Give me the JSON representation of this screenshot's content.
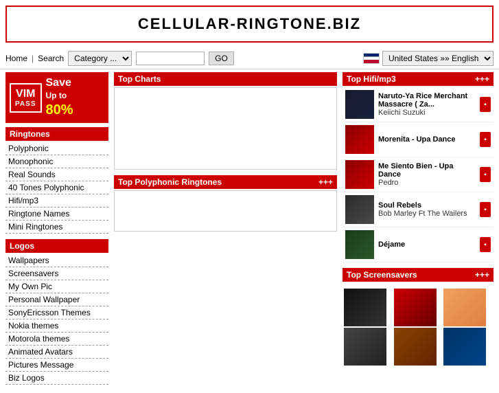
{
  "header": {
    "title": "CELLULAR-RINGTONE.BIZ"
  },
  "toolbar": {
    "home_label": "Home",
    "separator": "|",
    "search_label": "Search",
    "category_placeholder": "Category ...",
    "go_button": "GO",
    "language": {
      "country": "United States",
      "separator": "»»",
      "lang": "English"
    }
  },
  "ad": {
    "vim": "VIM",
    "pass": "PASS",
    "save": "Save",
    "up_to": "Up to",
    "percent": "80%"
  },
  "ringtones_section": {
    "header": "Ringtones",
    "items": [
      {
        "label": "Polyphonic"
      },
      {
        "label": "Monophonic"
      },
      {
        "label": "Real Sounds"
      },
      {
        "label": "40 Tones Polyphonic"
      },
      {
        "label": "Hifi/mp3"
      },
      {
        "label": "Ringtone Names"
      },
      {
        "label": "Mini Ringtones"
      }
    ]
  },
  "logos_section": {
    "header": "Logos",
    "items": [
      {
        "label": "Wallpapers"
      },
      {
        "label": "Screensavers"
      },
      {
        "label": "My Own Pic"
      },
      {
        "label": "Personal Wallpaper"
      },
      {
        "label": "SonyEricsson Themes"
      },
      {
        "label": "Nokia themes"
      },
      {
        "label": "Motorola themes"
      },
      {
        "label": "Animated Avatars"
      },
      {
        "label": "Pictures Message"
      },
      {
        "label": "Biz Logos"
      }
    ]
  },
  "top_charts": {
    "header": "Top Charts"
  },
  "top_polyphonic": {
    "header": "Top Polyphonic Ringtones",
    "plus": "+++"
  },
  "top_hifi": {
    "header": "Top Hifi/mp3",
    "plus": "+++",
    "items": [
      {
        "title": "Naruto-Ya Rice Merchant Massacre ( Za...",
        "artist": "Keiichi Suzuki",
        "thumb_class": "hit-thumb-naruto"
      },
      {
        "title": "Morenita - Upa Dance",
        "artist": "",
        "thumb_class": "hit-thumb-morenita"
      },
      {
        "title": "Me Siento Bien - Upa Dance",
        "artist": "Pedro",
        "thumb_class": "hit-thumb-pedro"
      },
      {
        "title": "Soul Rebels",
        "artist": "Bob Marley Ft The Wailers",
        "thumb_class": "hit-thumb-wailers"
      },
      {
        "title": "Déjame",
        "artist": "",
        "thumb_class": "hit-thumb-dejame"
      }
    ]
  },
  "top_screensavers": {
    "header": "Top Screensavers",
    "plus": "+++",
    "thumbs": [
      {
        "class": "ss-skull"
      },
      {
        "class": "ss-red"
      },
      {
        "class": "ss-cute"
      },
      {
        "class": "ss-more1"
      },
      {
        "class": "ss-more2"
      },
      {
        "class": "ss-blue"
      }
    ]
  }
}
